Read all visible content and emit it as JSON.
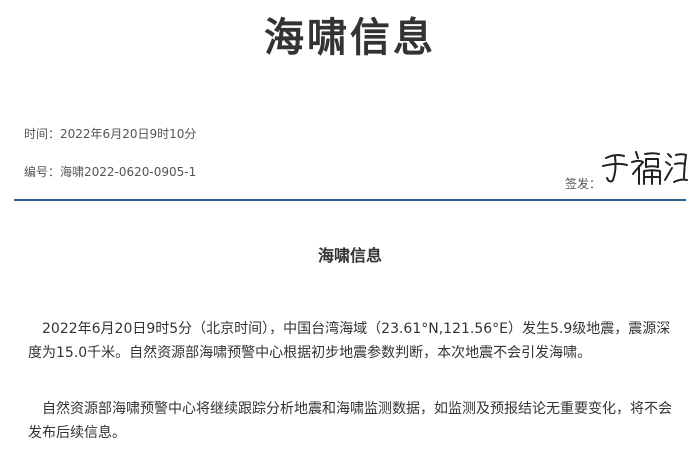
{
  "title": "海啸信息",
  "meta": {
    "time_label": "时间：",
    "time_value": "2022年6月20日9时10分",
    "number_label": "编号：",
    "number_value": "海啸2022-0620-0905-1",
    "signer_label": "签发：",
    "signature_text": "于福江"
  },
  "heading": "海啸信息",
  "paragraphs": [
    "2022年6月20日9时5分（北京时间），中国台湾海域（23.61°N,121.56°E）发生5.9级地震，震源深度为15.0千米。自然资源部海啸预警中心根据初步地震参数判断，本次地震不会引发海啸。",
    "自然资源部海啸预警中心将继续跟踪分析地震和海啸监测数据，如监测及预报结论无重要变化，将不会发布后续信息。"
  ],
  "colors": {
    "divider": "#2f6196",
    "text": "#333333"
  }
}
